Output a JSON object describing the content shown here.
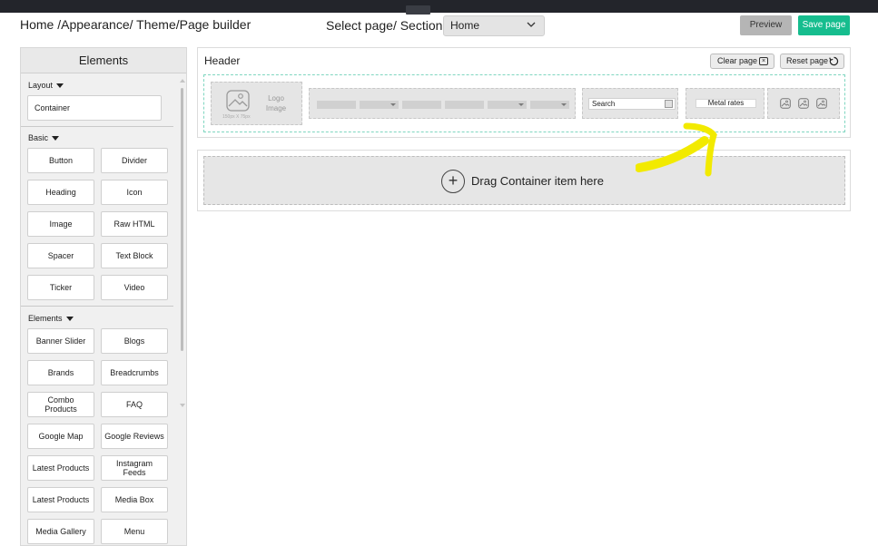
{
  "header": {
    "breadcrumb": "Home /Appearance/ Theme/Page builder",
    "select_label": "Select page/ Section:",
    "selected_page": "Home",
    "preview_label": "Preview",
    "save_label": "Save page"
  },
  "sidebar": {
    "title": "Elements",
    "layout_label": "Layout",
    "container_label": "Container",
    "basic_label": "Basic",
    "basic_items": [
      "Button",
      "Divider",
      "Heading",
      "Icon",
      "Image",
      "Raw HTML",
      "Spacer",
      "Text Block",
      "Ticker",
      "Video"
    ],
    "elements_label": "Elements",
    "element_items": [
      "Banner Slider",
      "Blogs",
      "Brands",
      "Breadcrumbs",
      "Combo Products",
      "FAQ",
      "Google Map",
      "Google Reviews",
      "Latest Products",
      "Instagram Feeds",
      "Latest Products",
      "Media Box",
      "Media Gallery",
      "Menu"
    ]
  },
  "canvas": {
    "title": "Header",
    "clear_label": "Clear page",
    "reset_label": "Reset page",
    "logo_text": "Logo Image",
    "logo_dims": "150px X 75px",
    "search_placeholder": "Search",
    "metal_label": "Metal rates",
    "drop_text": "Drag Container item here"
  },
  "colors": {
    "accent": "#16bd8e",
    "topbar": "#23252b",
    "highlight": "#f2ea00",
    "dashed_outline": "#7fd6c0"
  }
}
